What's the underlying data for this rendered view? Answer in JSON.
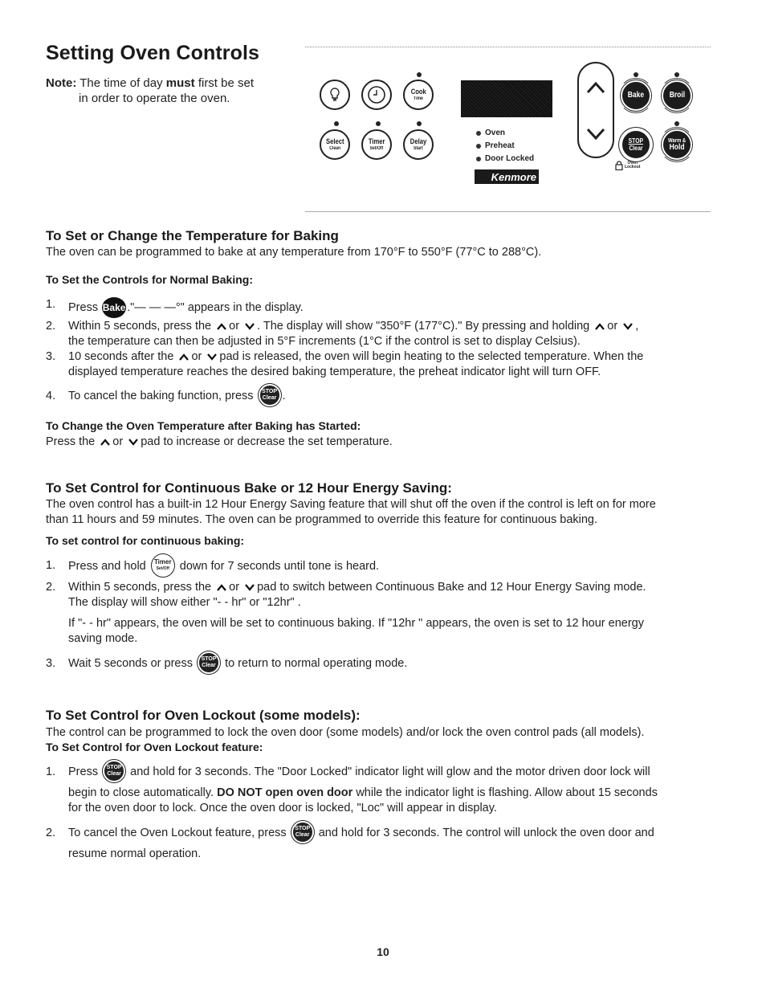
{
  "header": {
    "title": "Setting Oven Controls",
    "note_label": "Note:",
    "note_pre": "The time of day",
    "note_bold": "must",
    "note_post": "first be set",
    "note_line2": "in order to operate the oven."
  },
  "panel": {
    "pads": {
      "light": {
        "icon": "lightbulb-icon"
      },
      "clock": {
        "icon": "clock-icon"
      },
      "cook_time": {
        "line1": "Cook",
        "line2": "Time"
      },
      "select_clean": {
        "line1": "Select",
        "line2": "Clean"
      },
      "timer": {
        "line1": "Timer",
        "line2": "Set/Off"
      },
      "delay": {
        "line1": "Delay",
        "line2": "Start"
      },
      "bake": {
        "line1": "Bake"
      },
      "broil": {
        "line1": "Broil"
      },
      "stop": {
        "line1": "STOP",
        "line2": "Clear"
      },
      "warm": {
        "line1": "Warm &",
        "line2": "Hold"
      }
    },
    "indicators": [
      "Oven",
      "Preheat",
      "Door Locked"
    ],
    "brand": "Kenmore",
    "lockout_label_1": "Oven",
    "lockout_label_2": "Lockout"
  },
  "icons": {
    "bake": "Bake",
    "stop_1": "STOP",
    "stop_2": "Clear",
    "timer_1": "Timer",
    "timer_2": "Set/Off"
  },
  "sections": {
    "temp": {
      "heading": "To Set or Change the Temperature for Baking",
      "intro": "The oven can be programmed to bake at any temperature from 170°F to 550°F (77°C to 288°C).",
      "subheading": "To Set the Controls for Normal Baking:",
      "steps": [
        {
          "num": "1.",
          "pre": "Press",
          "post": ".\"— — —°\" appears in the display."
        },
        {
          "num": "2.",
          "a": "Within 5 seconds, press the",
          "b": "or",
          "c": ".  The display will show \"350°F (177°C).\" By pressing and holding",
          "d": "or",
          "e": ",",
          "line2": "the temperature can then be adjusted in 5°F increments (1°C if the control is set to display Celsius)."
        },
        {
          "num": "3.",
          "a": "10 seconds after the",
          "b": "or",
          "c": "pad is released, the oven will begin heating to the selected temperature. When the",
          "line2": "displayed temperature reaches the desired baking temperature, the preheat indicator light will turn OFF."
        },
        {
          "num": "4.",
          "pre": "To cancel the baking function, press",
          "post": "."
        }
      ],
      "change_heading": "To Change the Oven Temperature after Baking has Started:",
      "change_a": "Press the",
      "change_b": "or",
      "change_c": "pad to increase or decrease the set temperature."
    },
    "continuous": {
      "heading": "To Set Control for Continuous Bake or 12 Hour Energy Saving:",
      "intro_1": "The oven control has a built-in 12 Hour Energy Saving feature that will shut off the oven if the control is left on for more",
      "intro_2": "than 11 hours and 59 minutes. The oven can be programmed to override this feature for continuous baking.",
      "subheading": "To set control for continuous baking:",
      "step1": {
        "num": "1.",
        "pre": "Press and hold",
        "post": "down for 7 seconds until tone is heard."
      },
      "step2": {
        "num": "2.",
        "a": "Within 5 seconds, press the",
        "b": "or",
        "c": "pad to switch between Continuous Bake and 12 Hour Energy Saving mode.",
        "line2": "The display will show either \"- - hr\" or \"12hr\" ."
      },
      "step2_note_1": "If \"- - hr\" appears, the oven will be set to continuous baking. If \"12hr \" appears, the oven is set to 12 hour energy",
      "step2_note_2": "saving mode.",
      "step3": {
        "num": "3.",
        "pre": "Wait 5 seconds or press",
        "post": "to return to normal operating mode."
      }
    },
    "lockout": {
      "heading": "To Set Control for Oven Lockout (some models):",
      "intro": "The control can be programmed to lock the oven door (some models) and/or lock the oven control pads (all models).",
      "subheading": "To Set Control for Oven Lockout feature:",
      "step1": {
        "num": "1.",
        "pre": "Press",
        "post": "and hold for 3 seconds. The \"Door Locked\" indicator light will glow and the motor driven door lock will",
        "line2_pre": "begin to close automatically.",
        "line2_bold": "DO NOT open oven door",
        "line2_post": "while the indicator light is flashing. Allow about 15 seconds",
        "line3": "for the oven door to lock. Once the oven door is locked, \"Loc\" will appear in display."
      },
      "step2": {
        "num": "2.",
        "pre": "To cancel the Oven Lockout feature, press",
        "post": "and hold for 3 seconds. The control will unlock the oven door and",
        "line2": "resume normal operation."
      }
    }
  },
  "footer": {
    "page_number": "10"
  }
}
